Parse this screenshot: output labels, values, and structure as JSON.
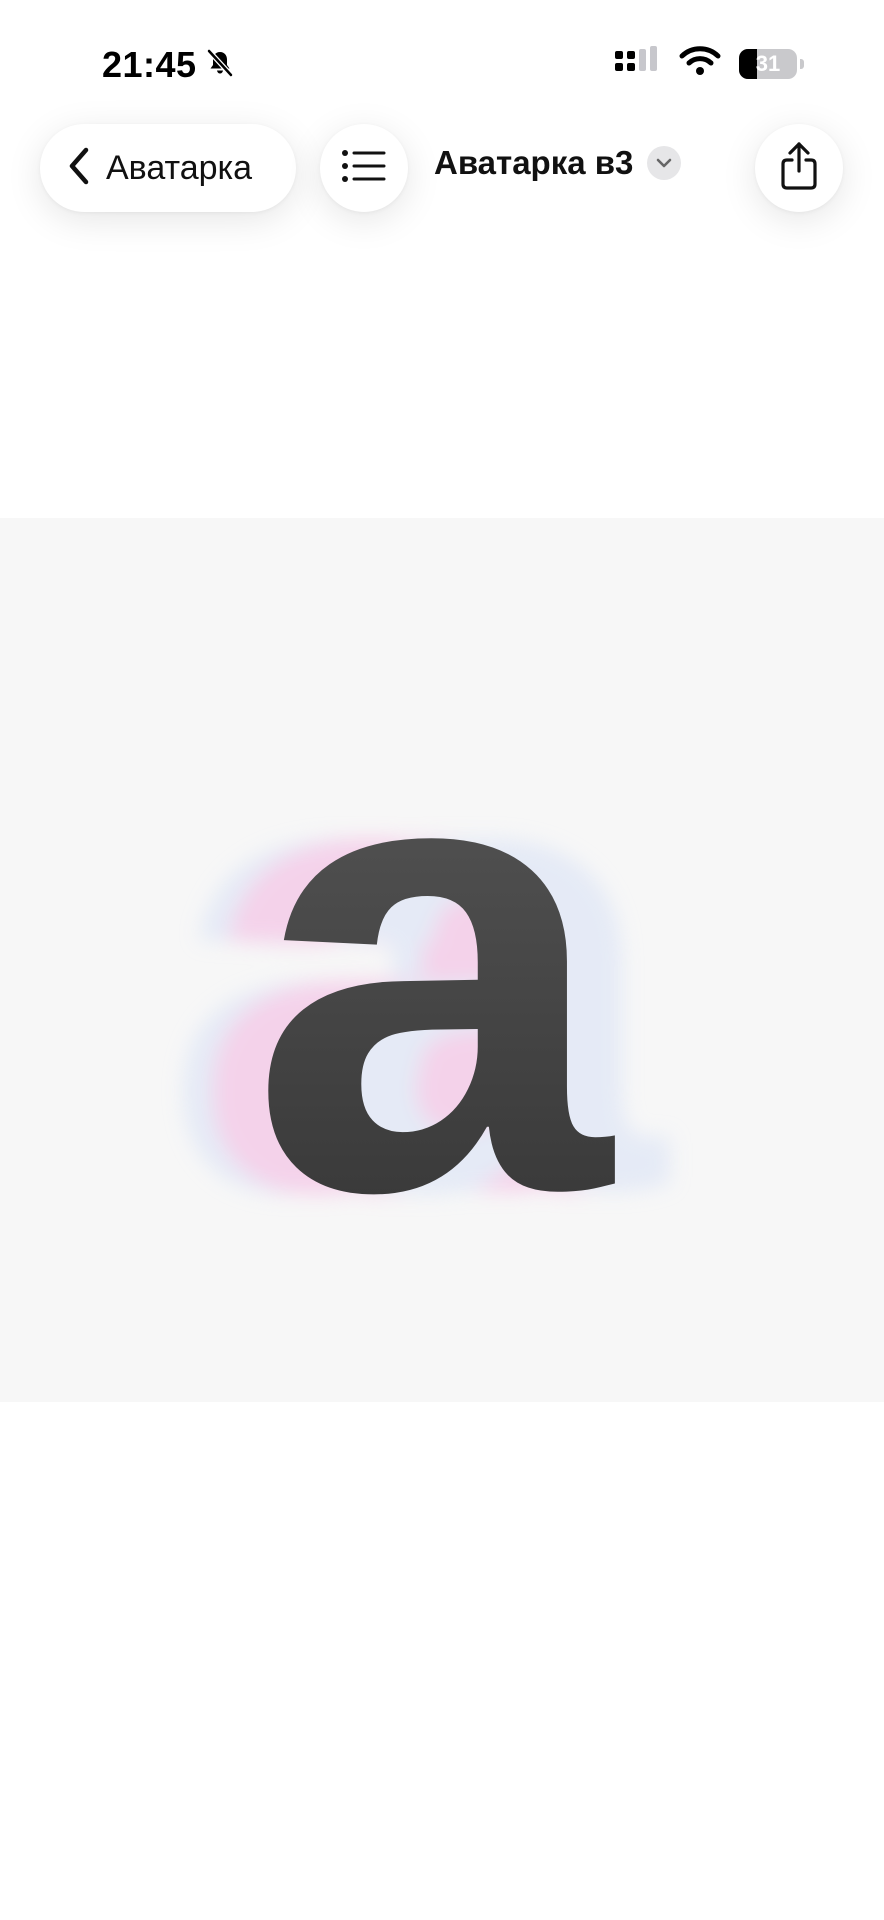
{
  "status_bar": {
    "time": "21:45",
    "mute_icon": "bell-slash-icon",
    "signal_icon": "cellular-signal-icon",
    "wifi_icon": "wifi-icon",
    "battery_level": "31",
    "battery_fraction": 0.31
  },
  "nav": {
    "back_label": "Аватарка",
    "back_icon": "chevron-left-icon",
    "list_icon": "list-icon",
    "title": "Аватарка в3",
    "title_chevron_icon": "chevron-down-icon",
    "share_icon": "share-icon"
  },
  "content": {
    "image_glyph": "a",
    "image_colors": {
      "background": "#f7f7f7",
      "glyph": "#3a3a3a",
      "glow_pink": "#f4c6e6",
      "glow_blue": "#dfe6f6"
    }
  }
}
